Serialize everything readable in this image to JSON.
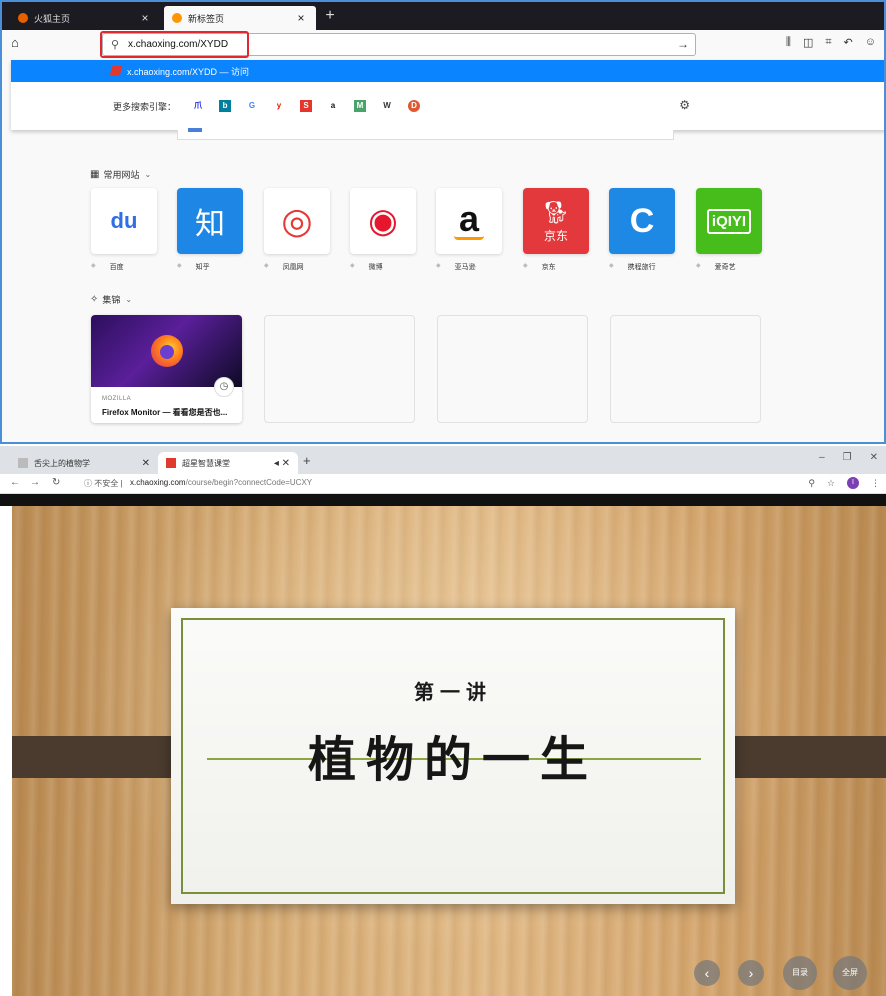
{
  "top_browser": {
    "tabs": [
      {
        "title": "火狐主页",
        "favicon_color": "#e66000"
      },
      {
        "title": "新标签页",
        "favicon_color": "#ff9500"
      }
    ],
    "home_icon": "home-icon",
    "url": "x.chaoxing.com/XYDD",
    "highlight_color": "#e0282e",
    "suggestion": {
      "text": "x.chaoxing.com/XYDD — 访问"
    },
    "search_engines_label": "更多搜索引擎：",
    "search_engines": [
      {
        "name": "baidu",
        "glyph": "爪",
        "color": "#2932e1"
      },
      {
        "name": "bing",
        "glyph": "b",
        "color": "#00809d"
      },
      {
        "name": "google",
        "glyph": "G",
        "color": "#4285f4"
      },
      {
        "name": "yandex",
        "glyph": "y",
        "color": "#e61400"
      },
      {
        "name": "sogou",
        "glyph": "S",
        "color": "#e5352c"
      },
      {
        "name": "amazon",
        "glyph": "a",
        "color": "#111111"
      },
      {
        "name": "map",
        "glyph": "M",
        "color": "#4aa36b"
      },
      {
        "name": "wikipedia",
        "glyph": "W",
        "color": "#333333"
      },
      {
        "name": "duckduckgo",
        "glyph": "D",
        "color": "#de5833"
      }
    ],
    "top_sites_label": "常用网站",
    "top_sites": [
      {
        "name": "百度",
        "tile_color": "#ffffff",
        "glyph": "du",
        "glyph_color": "#2f6fe4"
      },
      {
        "name": "知乎",
        "tile_color": "#1e87e5",
        "glyph": "知",
        "glyph_color": "#ffffff"
      },
      {
        "name": "凤凰网",
        "tile_color": "#ffffff",
        "glyph": "◎",
        "glyph_color": "#e53935"
      },
      {
        "name": "微博",
        "tile_color": "#ffffff",
        "glyph": "◉",
        "glyph_color": "#e6162d"
      },
      {
        "name": "亚马逊",
        "tile_color": "#ffffff",
        "glyph": "a",
        "glyph_color": "#111111"
      },
      {
        "name": "京东",
        "tile_color": "#e4393c",
        "glyph": "京东",
        "glyph_color": "#ffffff"
      },
      {
        "name": "携程旅行",
        "tile_color": "#1e88e5",
        "glyph": "C",
        "glyph_color": "#ffffff"
      },
      {
        "name": "爱奇艺",
        "tile_color": "#46bd1b",
        "glyph": "iQIYI",
        "glyph_color": "#ffffff"
      }
    ],
    "highlights_label": "集锦",
    "highlight_card": {
      "source": "MOZILLA",
      "title": "Firefox Monitor — 看看您是否也..."
    }
  },
  "bottom_browser": {
    "tabs": [
      {
        "title": "舌尖上的植物学",
        "favicon_color": "#bbbbbb"
      },
      {
        "title": "超星智慧课堂",
        "favicon_color": "#e03a2f"
      }
    ],
    "new_tab": "+",
    "window_controls": [
      "–",
      "❐",
      "✕"
    ],
    "security_text": "不安全",
    "url_host": "x.chaoxing.com",
    "url_path": "/course/begin?connectCode=UCXY",
    "profile_initial": "I",
    "slide": {
      "subtitle": "第一讲",
      "title": "植物的一生"
    },
    "controls": {
      "prev": "‹",
      "next": "›",
      "toc": "目录",
      "fullscreen": "全屏"
    }
  }
}
